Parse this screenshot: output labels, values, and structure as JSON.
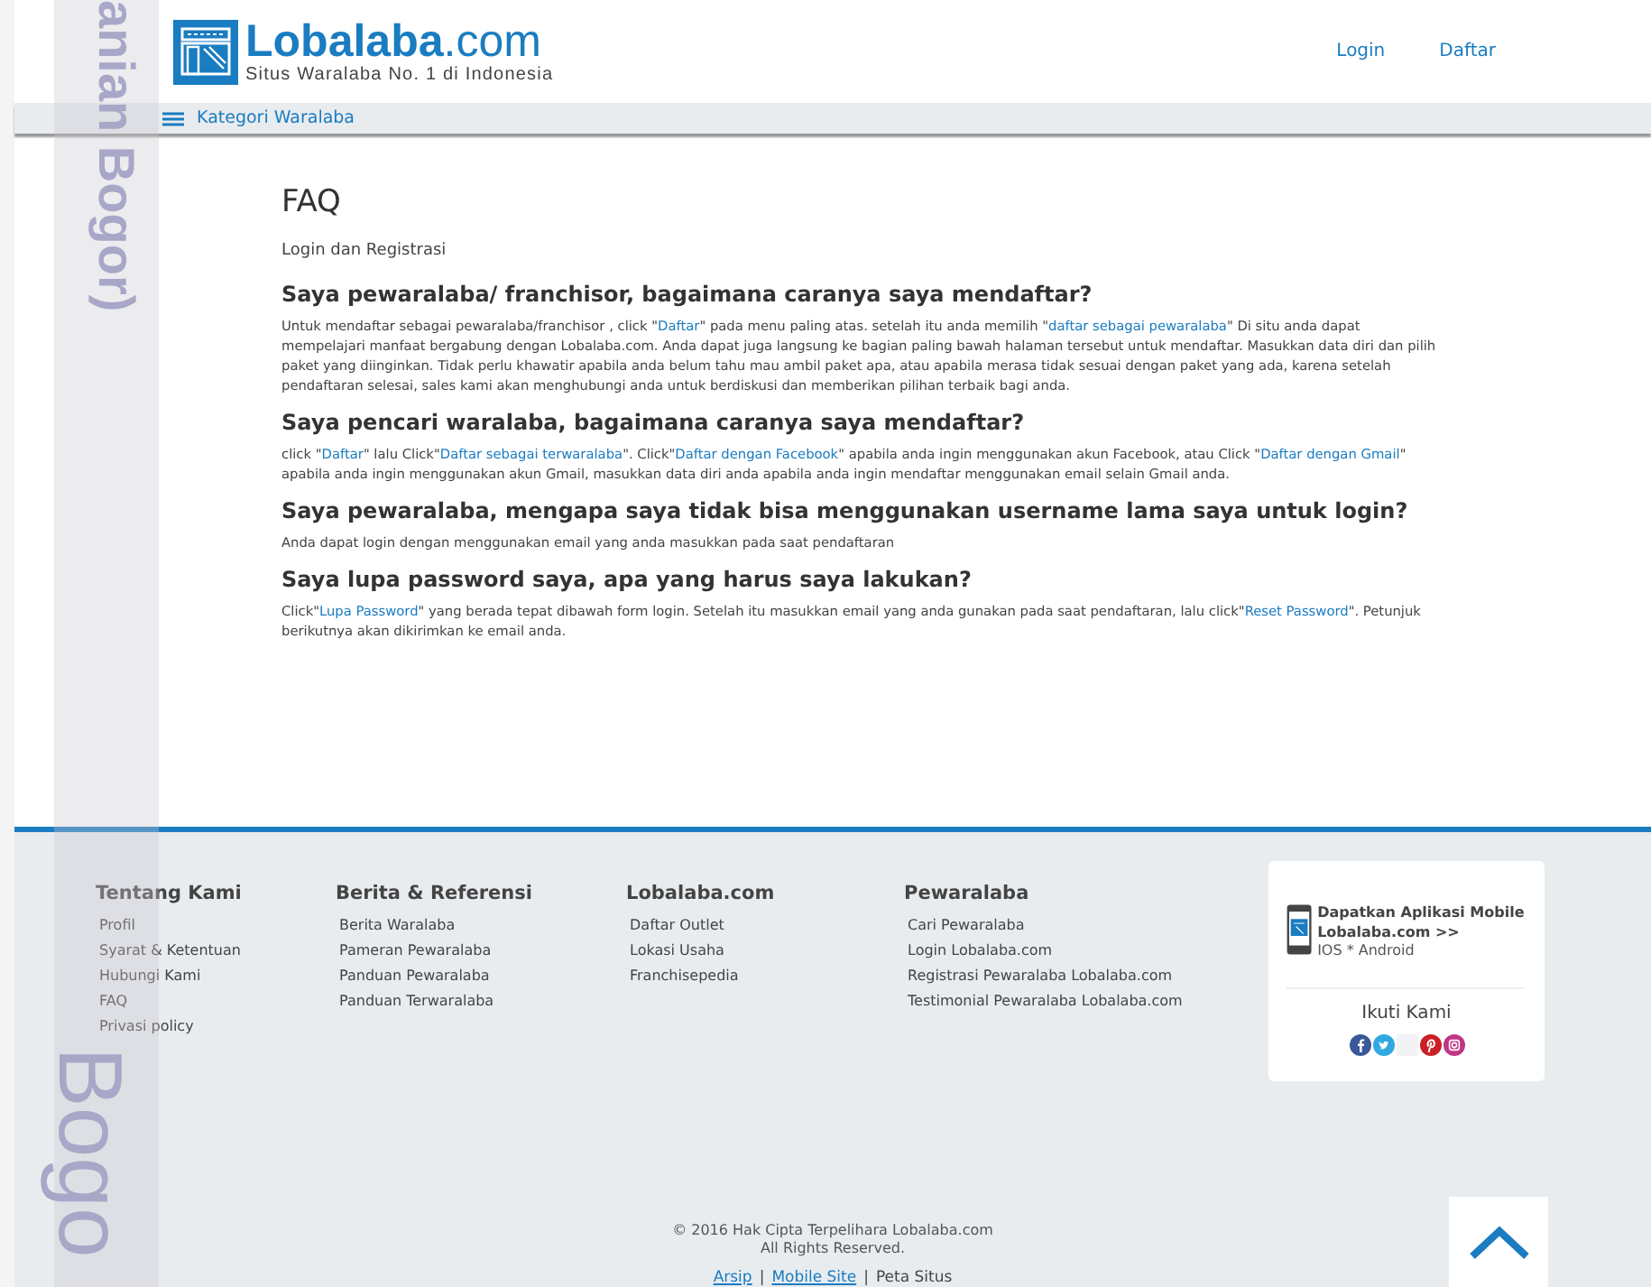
{
  "side_banner": {
    "top_text": "anian Bogor)",
    "bottom_text": "Bogo"
  },
  "header": {
    "logo": {
      "name": "**Lobalaba**.com",
      "tagline": "Situs Waralaba No. 1 di Indonesia"
    },
    "links": [
      "Login",
      "Daftar"
    ]
  },
  "nav": {
    "menu": "Kategori Waralaba"
  },
  "page": {
    "title": "FAQ",
    "section": "Login dan Registrasi",
    "faqs": [
      {
        "question": "Saya pewaralaba/ franchisor,  bagaimana caranya saya mendaftar?",
        "answer": [
          {
            "text": "Untuk mendaftar sebagai pewaralaba/franchisor , click \"",
            "kind": "text"
          },
          {
            "text": "Daftar",
            "kind": "link"
          },
          {
            "text": "\" pada menu paling atas. setelah itu anda memilih \"",
            "kind": "text"
          },
          {
            "text": "daftar sebagai pewaralaba",
            "kind": "link"
          },
          {
            "text": "\" Di situ anda dapat mempelajari manfaat bergabung dengan Lobalaba.com. Anda dapat juga langsung ke bagian paling bawah halaman tersebut untuk mendaftar. Masukkan data diri dan pilih paket yang diinginkan. Tidak perlu khawatir apabila anda belum tahu mau ambil paket apa, atau apabila merasa tidak sesuai dengan paket yang ada, karena setelah pendaftaran selesai, sales kami akan menghubungi anda untuk berdiskusi dan memberikan pilihan terbaik bagi anda.",
            "kind": "text"
          }
        ]
      },
      {
        "question": "Saya pencari waralaba, bagaimana caranya saya mendaftar?",
        "answer": [
          {
            "text": "click \"",
            "kind": "text"
          },
          {
            "text": "Daftar",
            "kind": "link"
          },
          {
            "text": "\"  lalu Click\"",
            "kind": "text"
          },
          {
            "text": "Daftar sebagai terwaralaba",
            "kind": "link"
          },
          {
            "text": "\". Click\"",
            "kind": "text"
          },
          {
            "text": "Daftar dengan Facebook",
            "kind": "link"
          },
          {
            "text": "\" apabila anda ingin menggunakan akun Facebook, atau Click \"",
            "kind": "text"
          },
          {
            "text": "Daftar dengan Gmail",
            "kind": "link"
          },
          {
            "text": "\" apabila anda ingin menggunakan akun Gmail, masukkan data diri anda apabila anda ingin mendaftar menggunakan email selain Gmail anda.",
            "kind": "text"
          }
        ]
      },
      {
        "question": "Saya pewaralaba, mengapa saya tidak bisa menggunakan username lama saya untuk login?",
        "answer": [
          {
            "text": "Anda dapat login dengan menggunakan email yang anda masukkan pada saat pendaftaran",
            "kind": "text"
          }
        ]
      },
      {
        "question": "Saya lupa password saya, apa yang harus saya lakukan?",
        "answer": [
          {
            "text": "Click\"",
            "kind": "text"
          },
          {
            "text": "Lupa Password",
            "kind": "link"
          },
          {
            "text": "\" yang berada tepat dibawah form login. Setelah itu masukkan email yang anda gunakan pada saat pendaftaran, lalu click\"",
            "kind": "text"
          },
          {
            "text": "Reset Password",
            "kind": "link"
          },
          {
            "text": "\". Petunjuk berikutnya akan dikirimkan ke email anda.",
            "kind": "text"
          }
        ]
      }
    ]
  },
  "footer": {
    "columns": [
      {
        "title": "Tentang Kami",
        "links": [
          "Profil",
          "Syarat & Ketentuan",
          "Hubungi Kami",
          "FAQ",
          "Privasi policy"
        ]
      },
      {
        "title": "Berita & Referensi",
        "links": [
          "Berita Waralaba",
          "Pameran Pewaralaba",
          "Panduan Pewaralaba",
          "Panduan Terwaralaba"
        ]
      },
      {
        "title": "Lobalaba.com",
        "links": [
          "Daftar Outlet",
          "Lokasi Usaha",
          "Franchisepedia"
        ]
      },
      {
        "title": "Pewaralaba",
        "links": [
          "Cari Pewaralaba",
          "Login  Lobalaba.com",
          "Registrasi Pewaralaba Lobalaba.com",
          "Testimonial Pewaralaba Lobalaba.com"
        ]
      }
    ],
    "app_card": {
      "title": "Dapatkan Aplikasi Mobile Lobalaba.com >>",
      "platforms": "IOS * Android",
      "follow": "Ikuti Kami",
      "social": [
        {
          "kind": "facebook"
        },
        {
          "kind": "twitter"
        },
        {
          "kind": "blank"
        },
        {
          "kind": "pinterest"
        },
        {
          "kind": "instagram"
        }
      ]
    },
    "copyright": [
      "© 2016  Hak Cipta Terpelihara Lobalaba.com",
      "All Rights Reserved."
    ],
    "separator": "|",
    "bottom_links": [
      {
        "text": "Arsip",
        "kind": "link"
      },
      {
        "text": "Mobile Site",
        "kind": "link"
      },
      {
        "text": "Peta Situs",
        "kind": "text"
      }
    ]
  }
}
